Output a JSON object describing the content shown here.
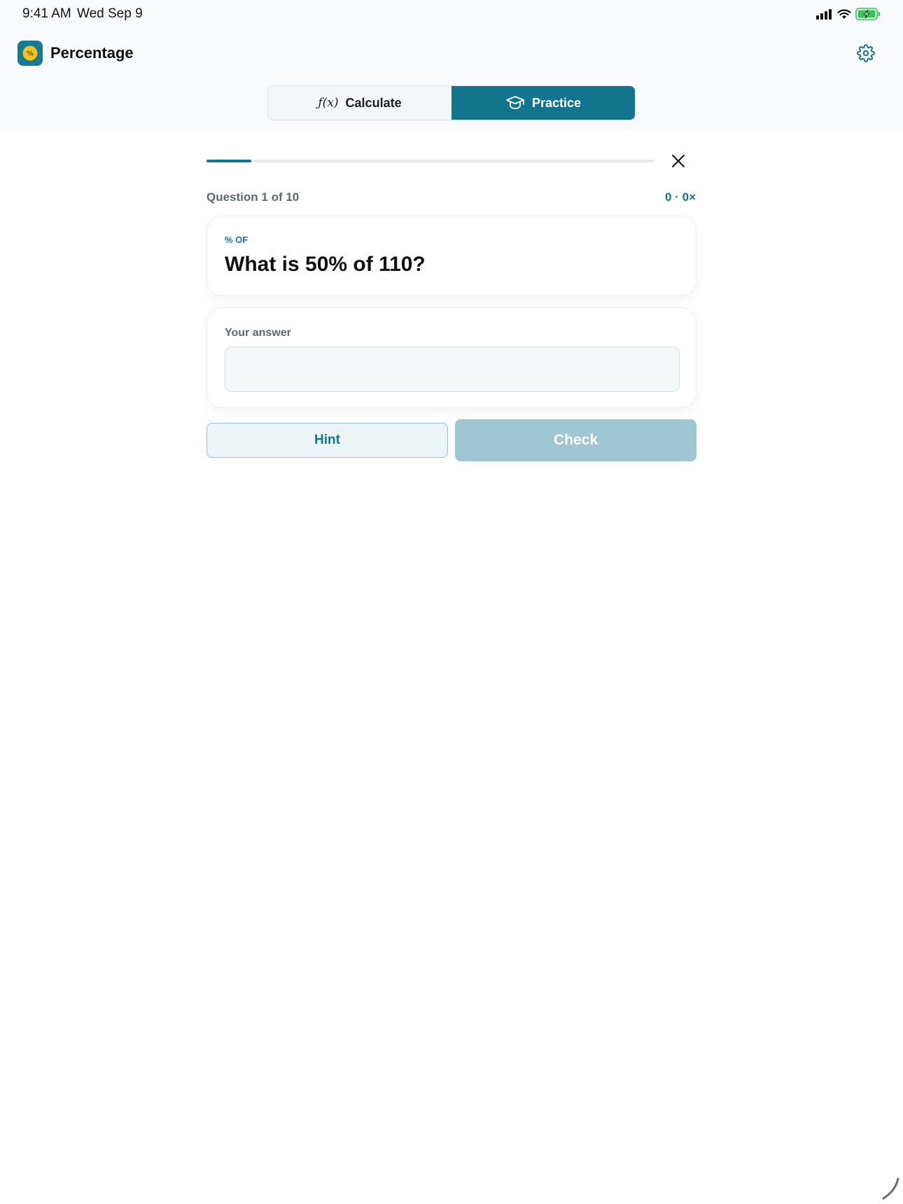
{
  "status_bar": {
    "time": "9:41 AM",
    "date": "Wed Sep 9"
  },
  "header": {
    "app_title": "Percentage",
    "app_icon_glyph": "%"
  },
  "tabs": [
    {
      "label": "Calculate",
      "icon": "fx-icon",
      "icon_glyph": "ƒ(x)",
      "active": false
    },
    {
      "label": "Practice",
      "icon": "graduation-cap-icon",
      "active": true
    }
  ],
  "practice": {
    "progress_fraction": 0.1,
    "question_counter": "Question 1 of 10",
    "score": "0 · 0×",
    "category": "% OF",
    "question": "What is 50% of 110?",
    "answer_label": "Your answer",
    "answer_value": "",
    "hint_label": "Hint",
    "check_label": "Check"
  },
  "colors": {
    "accent": "#13748e",
    "check_disabled": "#9fc7d3",
    "app_icon_badge": "#f0c419"
  }
}
